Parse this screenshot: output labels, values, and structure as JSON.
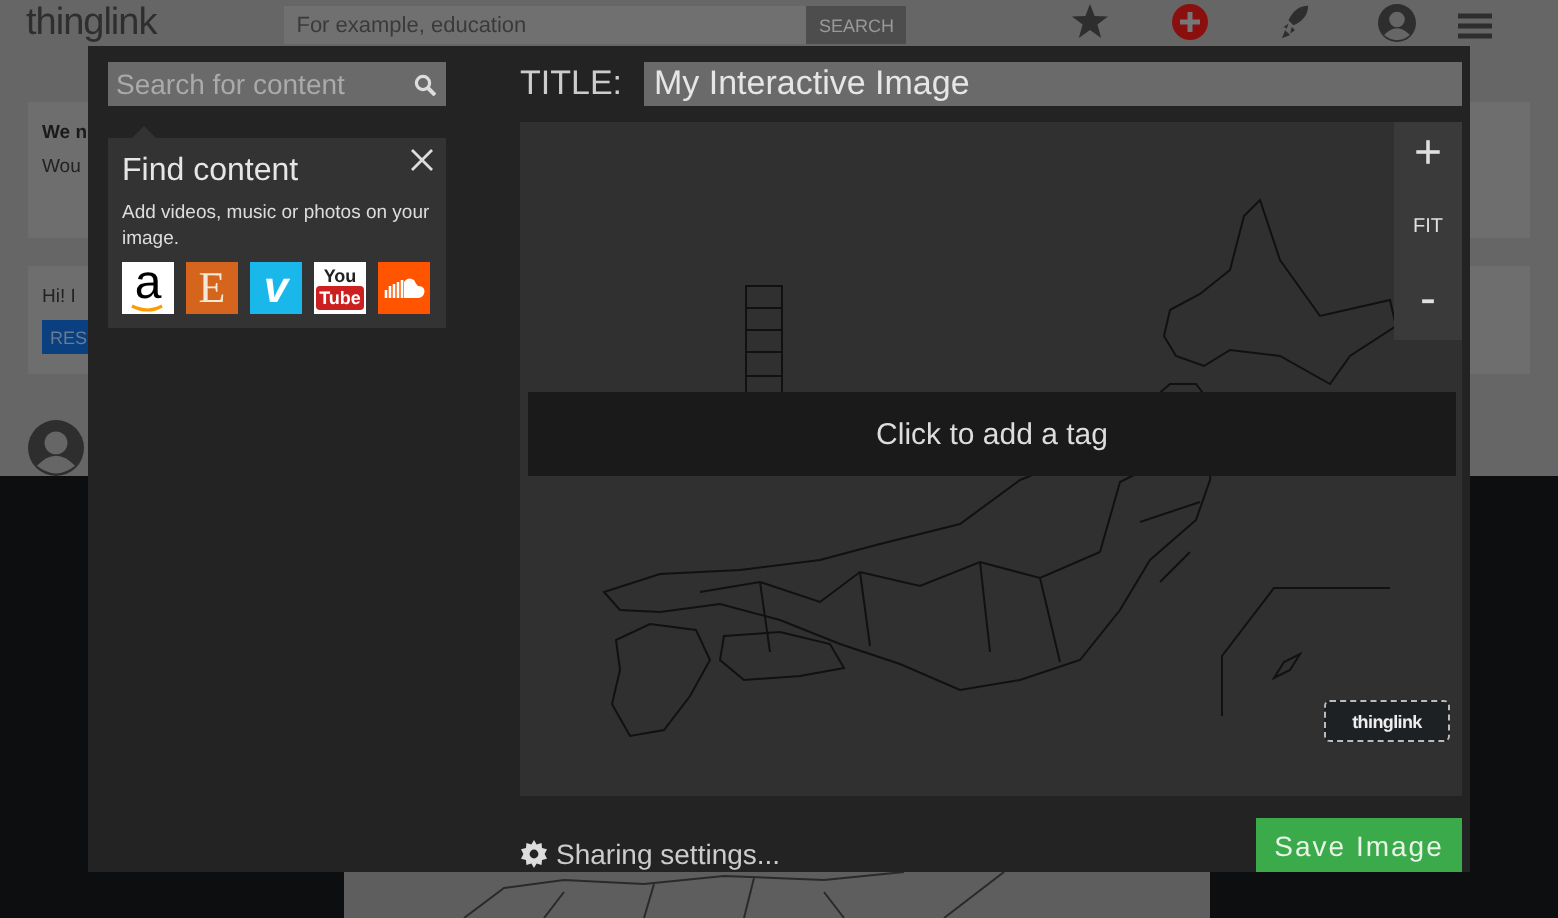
{
  "page": {
    "logo": "thinglink",
    "search": {
      "placeholder": "For example, education"
    },
    "search_button": "SEARCH",
    "cards": [
      {
        "title": "We n",
        "text": "Wou"
      },
      {
        "text": "Hi! I",
        "button": "RES"
      }
    ]
  },
  "dialog": {
    "search": {
      "placeholder": "Search for content"
    },
    "find_content": {
      "title": "Find content",
      "text": "Add videos, music or photos on your image.",
      "sources": [
        {
          "kind": "amazon",
          "label": "a"
        },
        {
          "kind": "etsy",
          "label": "E"
        },
        {
          "kind": "vimeo",
          "label": "v"
        },
        {
          "kind": "youtube",
          "label": "You",
          "label_2": "Tube"
        },
        {
          "kind": "soundcloud"
        }
      ]
    },
    "title_label": "TITLE:",
    "title_value": "My Interactive Image",
    "zoom": {
      "in": "+",
      "fit": "FIT",
      "out": "-"
    },
    "tag_bar": "Click to add a tag",
    "badge": "thinglink",
    "sharing": "Sharing settings...",
    "save_button": "Save Image"
  }
}
